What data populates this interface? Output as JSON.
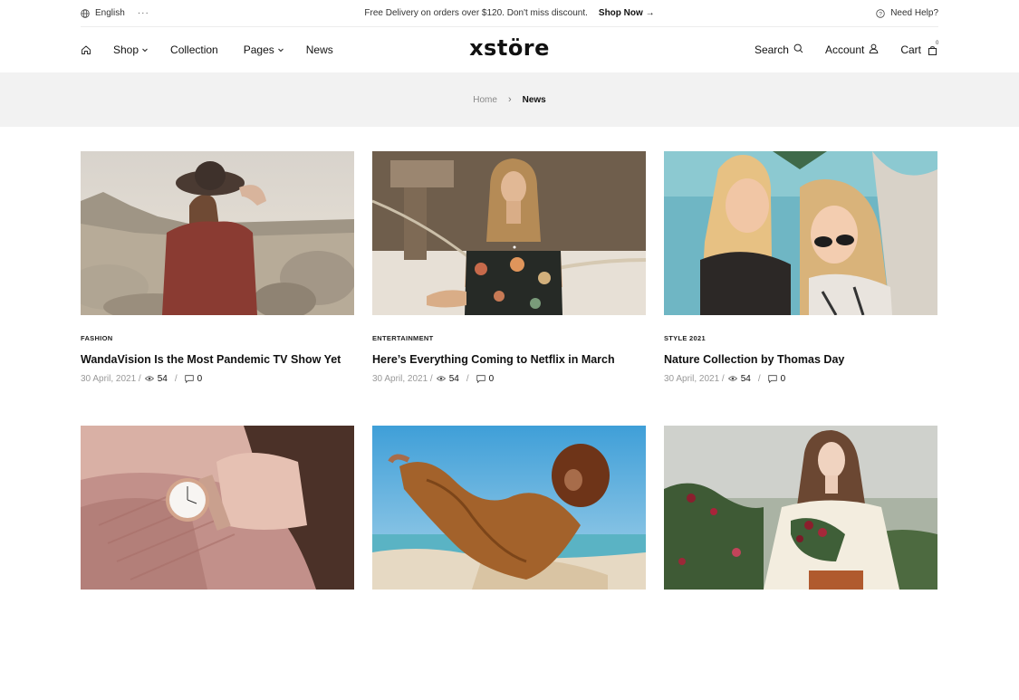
{
  "topbar": {
    "language": "English",
    "more": "···",
    "announcement": "Free Delivery on orders over $120. Don't miss discount.",
    "shop_now": "Shop Now",
    "help": "Need Help?"
  },
  "header": {
    "logo": "xstöre",
    "nav": [
      {
        "label": "Shop",
        "dropdown": true
      },
      {
        "label": "Collection",
        "dropdown": false
      },
      {
        "label": "Pages",
        "dropdown": true
      },
      {
        "label": "News",
        "dropdown": false
      }
    ],
    "search": "Search",
    "account": "Account",
    "cart": "Cart",
    "cart_count": "0"
  },
  "breadcrumb": {
    "home": "Home",
    "separator": "›",
    "current": "News"
  },
  "posts": [
    {
      "category": "FASHION",
      "title": "WandaVision Is the Most Pandemic TV Show Yet",
      "date": "30 April, 2021 /",
      "views": "54",
      "comments": "0"
    },
    {
      "category": "ENTERTAINMENT",
      "title": "Here’s Everything Coming to Netflix in March",
      "date": "30 April, 2021 /",
      "views": "54",
      "comments": "0"
    },
    {
      "category": "STYLE 2021",
      "title": "Nature Collection by Thomas Day",
      "date": "30 April, 2021 /",
      "views": "54",
      "comments": "0"
    },
    {
      "category": "",
      "title": "",
      "date": "",
      "views": "",
      "comments": ""
    },
    {
      "category": "",
      "title": "",
      "date": "",
      "views": "",
      "comments": ""
    },
    {
      "category": "",
      "title": "",
      "date": "",
      "views": "",
      "comments": ""
    }
  ],
  "colors": {
    "band": "#f2f2f2",
    "text": "#111111",
    "muted": "#999999"
  }
}
